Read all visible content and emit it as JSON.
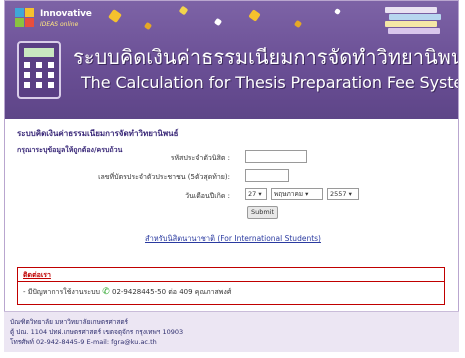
{
  "colors": {
    "banner": "#6a4f95",
    "heading": "#3b2a79",
    "contact_border": "#c00000",
    "link": "#2a3aa0",
    "footer_bg": "#ece6f3"
  },
  "logo": {
    "line1": "Innovative",
    "line2": "IDEAS online"
  },
  "banner": {
    "title_th": "ระบบคิดเงินค่าธรรมเนียมการจัดทำวิทยานิพนธ์",
    "title_en": "The Calculation for Thesis Preparation Fee System",
    "icons": [
      "calculator-icon",
      "books-icon"
    ]
  },
  "main": {
    "system_title": "ระบบคิดเงินค่าธรรมเนียมการจัดทำวิทยานิพนธ์",
    "instruction": "กรุณาระบุข้อมูลให้ถูกต้อง/ครบถ้วน",
    "form": {
      "student_id_label": "รหัสประจำตัวนิสิต :",
      "student_id_value": "",
      "national_id_label": "เลขที่บัตรประจำตัวประชาชน (5ตัวสุดท้าย):",
      "national_id_value": "",
      "birthdate_label": "วันเดือนปีเกิด :",
      "day": "27",
      "month": "พฤษภาคม",
      "year": "2557",
      "submit_label": "Submit"
    },
    "intl_link": "สำหรับนิสิตนานาชาติ (For International Students)"
  },
  "contact": {
    "title": "ติดต่อเรา",
    "line_prefix": "- มีปัญหาการใช้งานระบบ",
    "line_value": "02-9428445-50 ต่อ 409 คุณภาสพงศ์",
    "icon": "phone-icon"
  },
  "footer": {
    "line1": "บัณฑิตวิทยาลัย มหาวิทยาลัยเกษตรศาสตร์",
    "line2": "ตู้ ปณ. 1104 ปทฝ.เกษตรศาสตร์ เขตจตุจักร กรุงเทพฯ 10903",
    "line3": "โทรศัพท์ 02-942-8445-9 E-mail: fgra@ku.ac.th"
  }
}
